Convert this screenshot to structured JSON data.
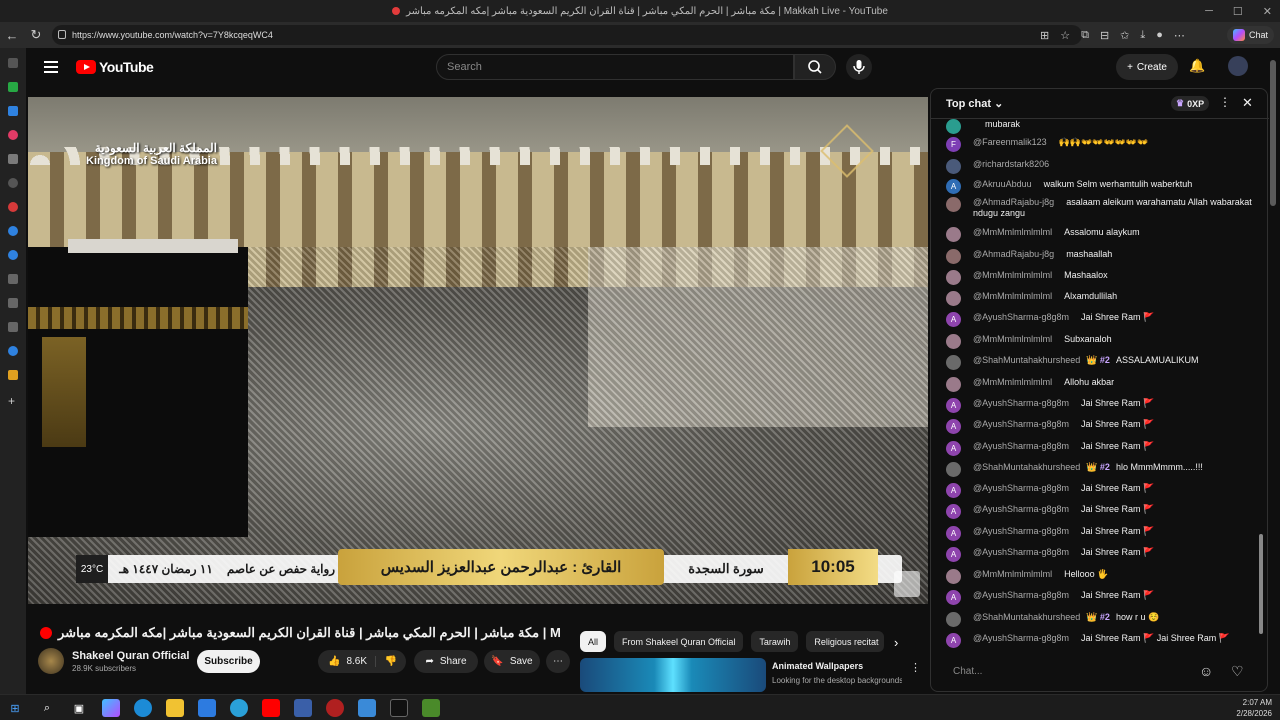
{
  "window": {
    "title": "مكة مباشر | الحرم المكي مباشر | قناة القران الكريم السعودية مباشر |مكه المكرمه مباشر | Makkah Live - YouTube"
  },
  "browser": {
    "url": "https://www.youtube.com/watch?v=7Y8kcqeqWC4",
    "chat_button": "Chat"
  },
  "header": {
    "logo_text": "YouTube",
    "search_placeholder": "Search",
    "create_label": "Create"
  },
  "video": {
    "overlay_ksa_ar": "المملكة العربية السعودية",
    "overlay_ksa_en": "Kingdom of Saudi Arabia",
    "temperature": "23°C",
    "date_ar": "١١ رمضان ١٤٤٧ هـ",
    "riwaya": "رواية حفص عن عاصم",
    "reciter": "القارئ : عبدالرحمن عبدالعزيز السديس",
    "surah": "سورة السجدة",
    "clock": "10:05",
    "title": "مكة مباشر | الحرم المكي مباشر | قناة القران الكريم السعودية مباشر |مكه المكرمه مباشر | Makkah Live"
  },
  "channel": {
    "name": "Shakeel Quran Official",
    "subscribers": "28.9K subscribers",
    "subscribe_label": "Subscribe"
  },
  "actions": {
    "likes": "8.6K",
    "share": "Share",
    "save": "Save"
  },
  "chips": [
    "All",
    "From Shakeel Quran Official",
    "Tarawih",
    "Religious recitat"
  ],
  "recommendation": {
    "title": "Animated Wallpapers",
    "desc": "Looking for the desktop backgrounds? Explore a curated"
  },
  "chat": {
    "mode": "Top chat",
    "xp": "0XP",
    "input_placeholder": "Chat...",
    "messages": [
      {
        "author": "",
        "text": "mubarak",
        "badge": "",
        "avatar": "",
        "color": "#2a9d8f"
      },
      {
        "author": "@Fareenmalik123",
        "text": "🙌🙌👐👐👐👐👐👐",
        "badge": "",
        "avatar": "F",
        "color": "#7e3fb5"
      },
      {
        "author": "@richardstark8206",
        "text": "",
        "badge": "",
        "avatar": "",
        "color": "#4a5a7a"
      },
      {
        "author": "@AkruuAbduu",
        "text": "walkum Selm werhamtulih waberktuh",
        "badge": "",
        "avatar": "A",
        "color": "#2f6db5"
      },
      {
        "author": "@AhmadRajabu-j8g",
        "text": "asalaam aleikum warahamatu Allah wabarakat ndugu zangu",
        "badge": "",
        "avatar": "",
        "color": "#8a6a6a"
      },
      {
        "author": "@MmMmlmlmlmlml",
        "text": "Assalomu alaykum",
        "badge": "",
        "avatar": "",
        "color": "#9a7a8a"
      },
      {
        "author": "@AhmadRajabu-j8g",
        "text": "mashaallah",
        "badge": "",
        "avatar": "",
        "color": "#8a6a6a"
      },
      {
        "author": "@MmMmlmlmlmlml",
        "text": "Mashaalox",
        "badge": "",
        "avatar": "",
        "color": "#9a7a8a"
      },
      {
        "author": "@MmMmlmlmlmlml",
        "text": "Alxamdullilah",
        "badge": "",
        "avatar": "",
        "color": "#9a7a8a"
      },
      {
        "author": "@AyushSharma-g8g8m",
        "text": "Jai Shree Ram 🚩",
        "badge": "",
        "avatar": "A",
        "color": "#8e44ad"
      },
      {
        "author": "@MmMmlmlmlmlml",
        "text": "Subxanaloh",
        "badge": "",
        "avatar": "",
        "color": "#9a7a8a"
      },
      {
        "author": "@ShahMuntahakhursheed",
        "text": "ASSALAMUALIKUM",
        "badge": "👑 #2",
        "avatar": "",
        "color": "#6a6a6a"
      },
      {
        "author": "@MmMmlmlmlmlml",
        "text": "Allohu akbar",
        "badge": "",
        "avatar": "",
        "color": "#9a7a8a"
      },
      {
        "author": "@AyushSharma-g8g8m",
        "text": "Jai Shree Ram 🚩",
        "badge": "",
        "avatar": "A",
        "color": "#8e44ad"
      },
      {
        "author": "@AyushSharma-g8g8m",
        "text": "Jai Shree Ram 🚩",
        "badge": "",
        "avatar": "A",
        "color": "#8e44ad"
      },
      {
        "author": "@AyushSharma-g8g8m",
        "text": "Jai Shree Ram 🚩",
        "badge": "",
        "avatar": "A",
        "color": "#8e44ad"
      },
      {
        "author": "@ShahMuntahakhursheed",
        "text": "hlo MmmMmmm.....!!!",
        "badge": "👑 #2",
        "avatar": "",
        "color": "#6a6a6a"
      },
      {
        "author": "@AyushSharma-g8g8m",
        "text": "Jai Shree Ram 🚩",
        "badge": "",
        "avatar": "A",
        "color": "#8e44ad"
      },
      {
        "author": "@AyushSharma-g8g8m",
        "text": "Jai Shree Ram 🚩",
        "badge": "",
        "avatar": "A",
        "color": "#8e44ad"
      },
      {
        "author": "@AyushSharma-g8g8m",
        "text": "Jai Shree Ram 🚩",
        "badge": "",
        "avatar": "A",
        "color": "#8e44ad"
      },
      {
        "author": "@AyushSharma-g8g8m",
        "text": "Jai Shree Ram 🚩",
        "badge": "",
        "avatar": "A",
        "color": "#8e44ad"
      },
      {
        "author": "@MmMmlmlmlmlml",
        "text": "Hellooo 🖐",
        "badge": "",
        "avatar": "",
        "color": "#9a7a8a"
      },
      {
        "author": "@AyushSharma-g8g8m",
        "text": "Jai Shree Ram 🚩",
        "badge": "",
        "avatar": "A",
        "color": "#8e44ad"
      },
      {
        "author": "@ShahMuntahakhursheed",
        "text": "how r u ☺️",
        "badge": "👑 #2",
        "avatar": "",
        "color": "#6a6a6a"
      },
      {
        "author": "@AyushSharma-g8g8m",
        "text": "Jai Shree Ram 🚩 Jai Shree Ram 🚩",
        "badge": "",
        "avatar": "A",
        "color": "#8e44ad"
      }
    ]
  },
  "taskbar": {
    "time": "2:07 AM",
    "date": "2/28/2026"
  }
}
